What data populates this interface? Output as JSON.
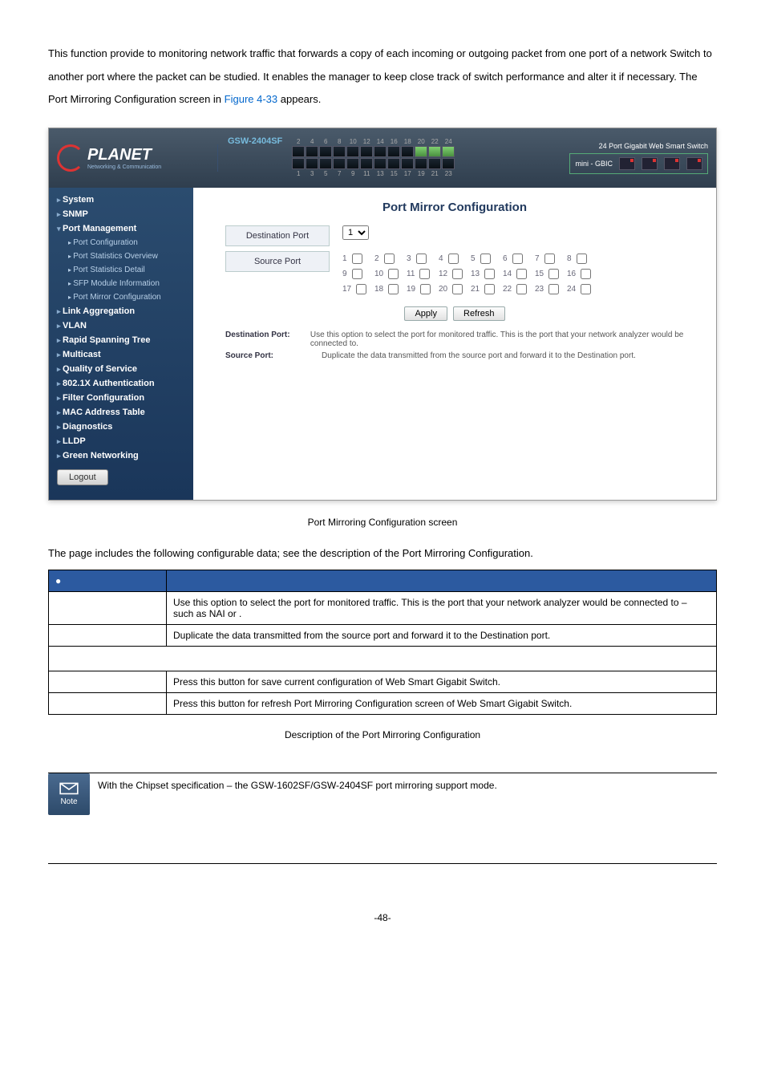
{
  "intro": {
    "text_prefix": "This function provide to monitoring network traffic that forwards a copy of each incoming or outgoing packet from one port of a network Switch to another port where the packet can be studied. It enables the manager to keep close track of switch performance and alter it if necessary. The Port Mirroring Configuration screen in ",
    "fig_ref": "Figure 4-33",
    "text_suffix": " appears."
  },
  "screenshot": {
    "logo_brand": "PLANET",
    "logo_tag": "Networking & Communication",
    "model": "GSW-2404SF",
    "header_right_line1": "24 Port Gigabit Web Smart Switch",
    "header_right_line2": "mini - GBIC",
    "top_port_numbers": [
      "2",
      "4",
      "6",
      "8",
      "10",
      "12",
      "14",
      "16",
      "18",
      "20",
      "22",
      "24"
    ],
    "bottom_port_numbers": [
      "1",
      "3",
      "5",
      "7",
      "9",
      "11",
      "13",
      "15",
      "17",
      "19",
      "21",
      "23"
    ],
    "sidebar": {
      "system": "System",
      "snmp": "SNMP",
      "port_management": "Port Management",
      "port_configuration": "Port Configuration",
      "port_stats_overview": "Port Statistics Overview",
      "port_stats_detail": "Port Statistics Detail",
      "sfp_module": "SFP Module Information",
      "port_mirror": "Port Mirror Configuration",
      "link_agg": "Link Aggregation",
      "vlan": "VLAN",
      "rstp": "Rapid Spanning Tree",
      "multicast": "Multicast",
      "qos": "Quality of Service",
      "dot1x": "802.1X Authentication",
      "filter": "Filter Configuration",
      "mac": "MAC Address Table",
      "diag": "Diagnostics",
      "lldp": "LLDP",
      "green": "Green Networking",
      "logout": "Logout"
    },
    "main": {
      "title": "Port Mirror Configuration",
      "dest_label": "Destination Port",
      "dest_value": "1",
      "source_label": "Source Port",
      "ports_row1": [
        "1",
        "2",
        "3",
        "4",
        "5",
        "6",
        "7",
        "8"
      ],
      "ports_row2": [
        "9",
        "10",
        "11",
        "12",
        "13",
        "14",
        "15",
        "16"
      ],
      "ports_row3": [
        "17",
        "18",
        "19",
        "20",
        "21",
        "22",
        "23",
        "24"
      ],
      "apply_btn": "Apply",
      "refresh_btn": "Refresh",
      "desc_dest_label": "Destination Port:",
      "desc_dest_text": "Use this option to select the port for monitored traffic. This is the port that your network analyzer would be connected to.",
      "desc_src_label": "Source Port:",
      "desc_src_text": "Duplicate the data transmitted from the source port and forward it to the Destination port."
    }
  },
  "fig_caption": "Port Mirroring Configuration screen",
  "table_intro_prefix": "The page includes the following configurable data; see the ",
  "table_intro_suffix": " description of the Port Mirroring Configuration.",
  "table": {
    "head_object": "●",
    "head_desc": "",
    "rows": [
      {
        "obj": "",
        "desc": "Use this option to select the port for monitored traffic. This is the port that your network analyzer would be connected to – such as NAI          or          ."
      },
      {
        "obj": "",
        "desc": "Duplicate the data transmitted from the source port and forward it to the Destination port."
      },
      {
        "obj": "",
        "desc": "",
        "span": true
      },
      {
        "obj": "",
        "desc": "Press this button for save current configuration of Web Smart Gigabit Switch."
      },
      {
        "obj": "",
        "desc": "Press this button for refresh Port Mirroring Configuration screen of Web Smart Gigabit Switch."
      }
    ]
  },
  "table_caption": "Description of the Port Mirroring Configuration",
  "note": {
    "label": "Note",
    "text": "With the Chipset specification – the GSW-1602SF/GSW-2404SF port mirroring support             mode."
  },
  "page_number": "-48-"
}
